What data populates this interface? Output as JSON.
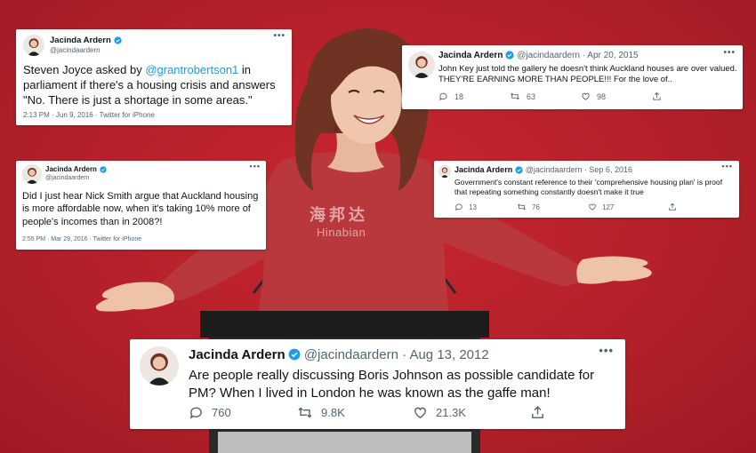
{
  "colors": {
    "background": "#b9202a",
    "card": "#ffffff",
    "text": "#0f1419",
    "muted": "#536471",
    "link": "#1d9bf0",
    "verified": "#1d9bf0",
    "dress": "#b8383b",
    "hair": "#6e3322",
    "podium": "#1c1c1c"
  },
  "icons": {
    "verified": "verified-badge-icon",
    "more": "more-options-icon",
    "reply": "reply-icon",
    "retweet": "retweet-icon",
    "like": "heart-icon",
    "share": "share-icon"
  },
  "tweets": {
    "t1": {
      "name": "Jacinda Ardern",
      "handle": "@jacindaardern",
      "more": "•••",
      "text_before": "Steven Joyce asked by ",
      "mention": "@grantrobertson1",
      "text_after": " in parliament if there's a housing crisis and answers \"No. There is just a shortage in some areas.\"",
      "meta": "2:13 PM · Jun 9, 2016 · Twitter for iPhone"
    },
    "t2": {
      "name": "Jacinda Ardern",
      "handle": "@jacindaardern",
      "date": "· Apr 20, 2015",
      "more": "•••",
      "text": "John Key just told the gallery he doesn't think Auckland houses are over valued. THEY'RE EARNING MORE THAN PEOPLE!!! For the love of..",
      "replies": "18",
      "retweets": "63",
      "likes": "98"
    },
    "t3": {
      "name": "Jacinda Ardern",
      "handle": "@jacindaardern",
      "more": "•••",
      "text": "Did I just hear Nick Smith argue that Auckland housing is more affordable now, when it's taking 10% more of people's incomes than in 2008?!",
      "meta": "2:55 PM · Mar 29, 2016 · Twitter for iPhone"
    },
    "t4": {
      "name": "Jacinda Ardern",
      "handle": "@jacindaardern",
      "date": "· Sep 6, 2016",
      "more": "•••",
      "text": "Government's constant reference to their 'comprehensive housing plan' is proof that repeating something constantly doesn't make it true",
      "replies": "13",
      "retweets": "76",
      "likes": "127"
    },
    "t5": {
      "name": "Jacinda Ardern",
      "handle": "@jacindaardern",
      "date": "· Aug 13, 2012",
      "more": "•••",
      "text": "Are people really discussing Boris Johnson as possible candidate for PM? When I lived in London he was known as the gaffe man!",
      "replies": "760",
      "retweets": "9.8K",
      "likes": "21.3K"
    }
  },
  "watermark": {
    "cn": "海邦达",
    "en": "Hinabian"
  }
}
